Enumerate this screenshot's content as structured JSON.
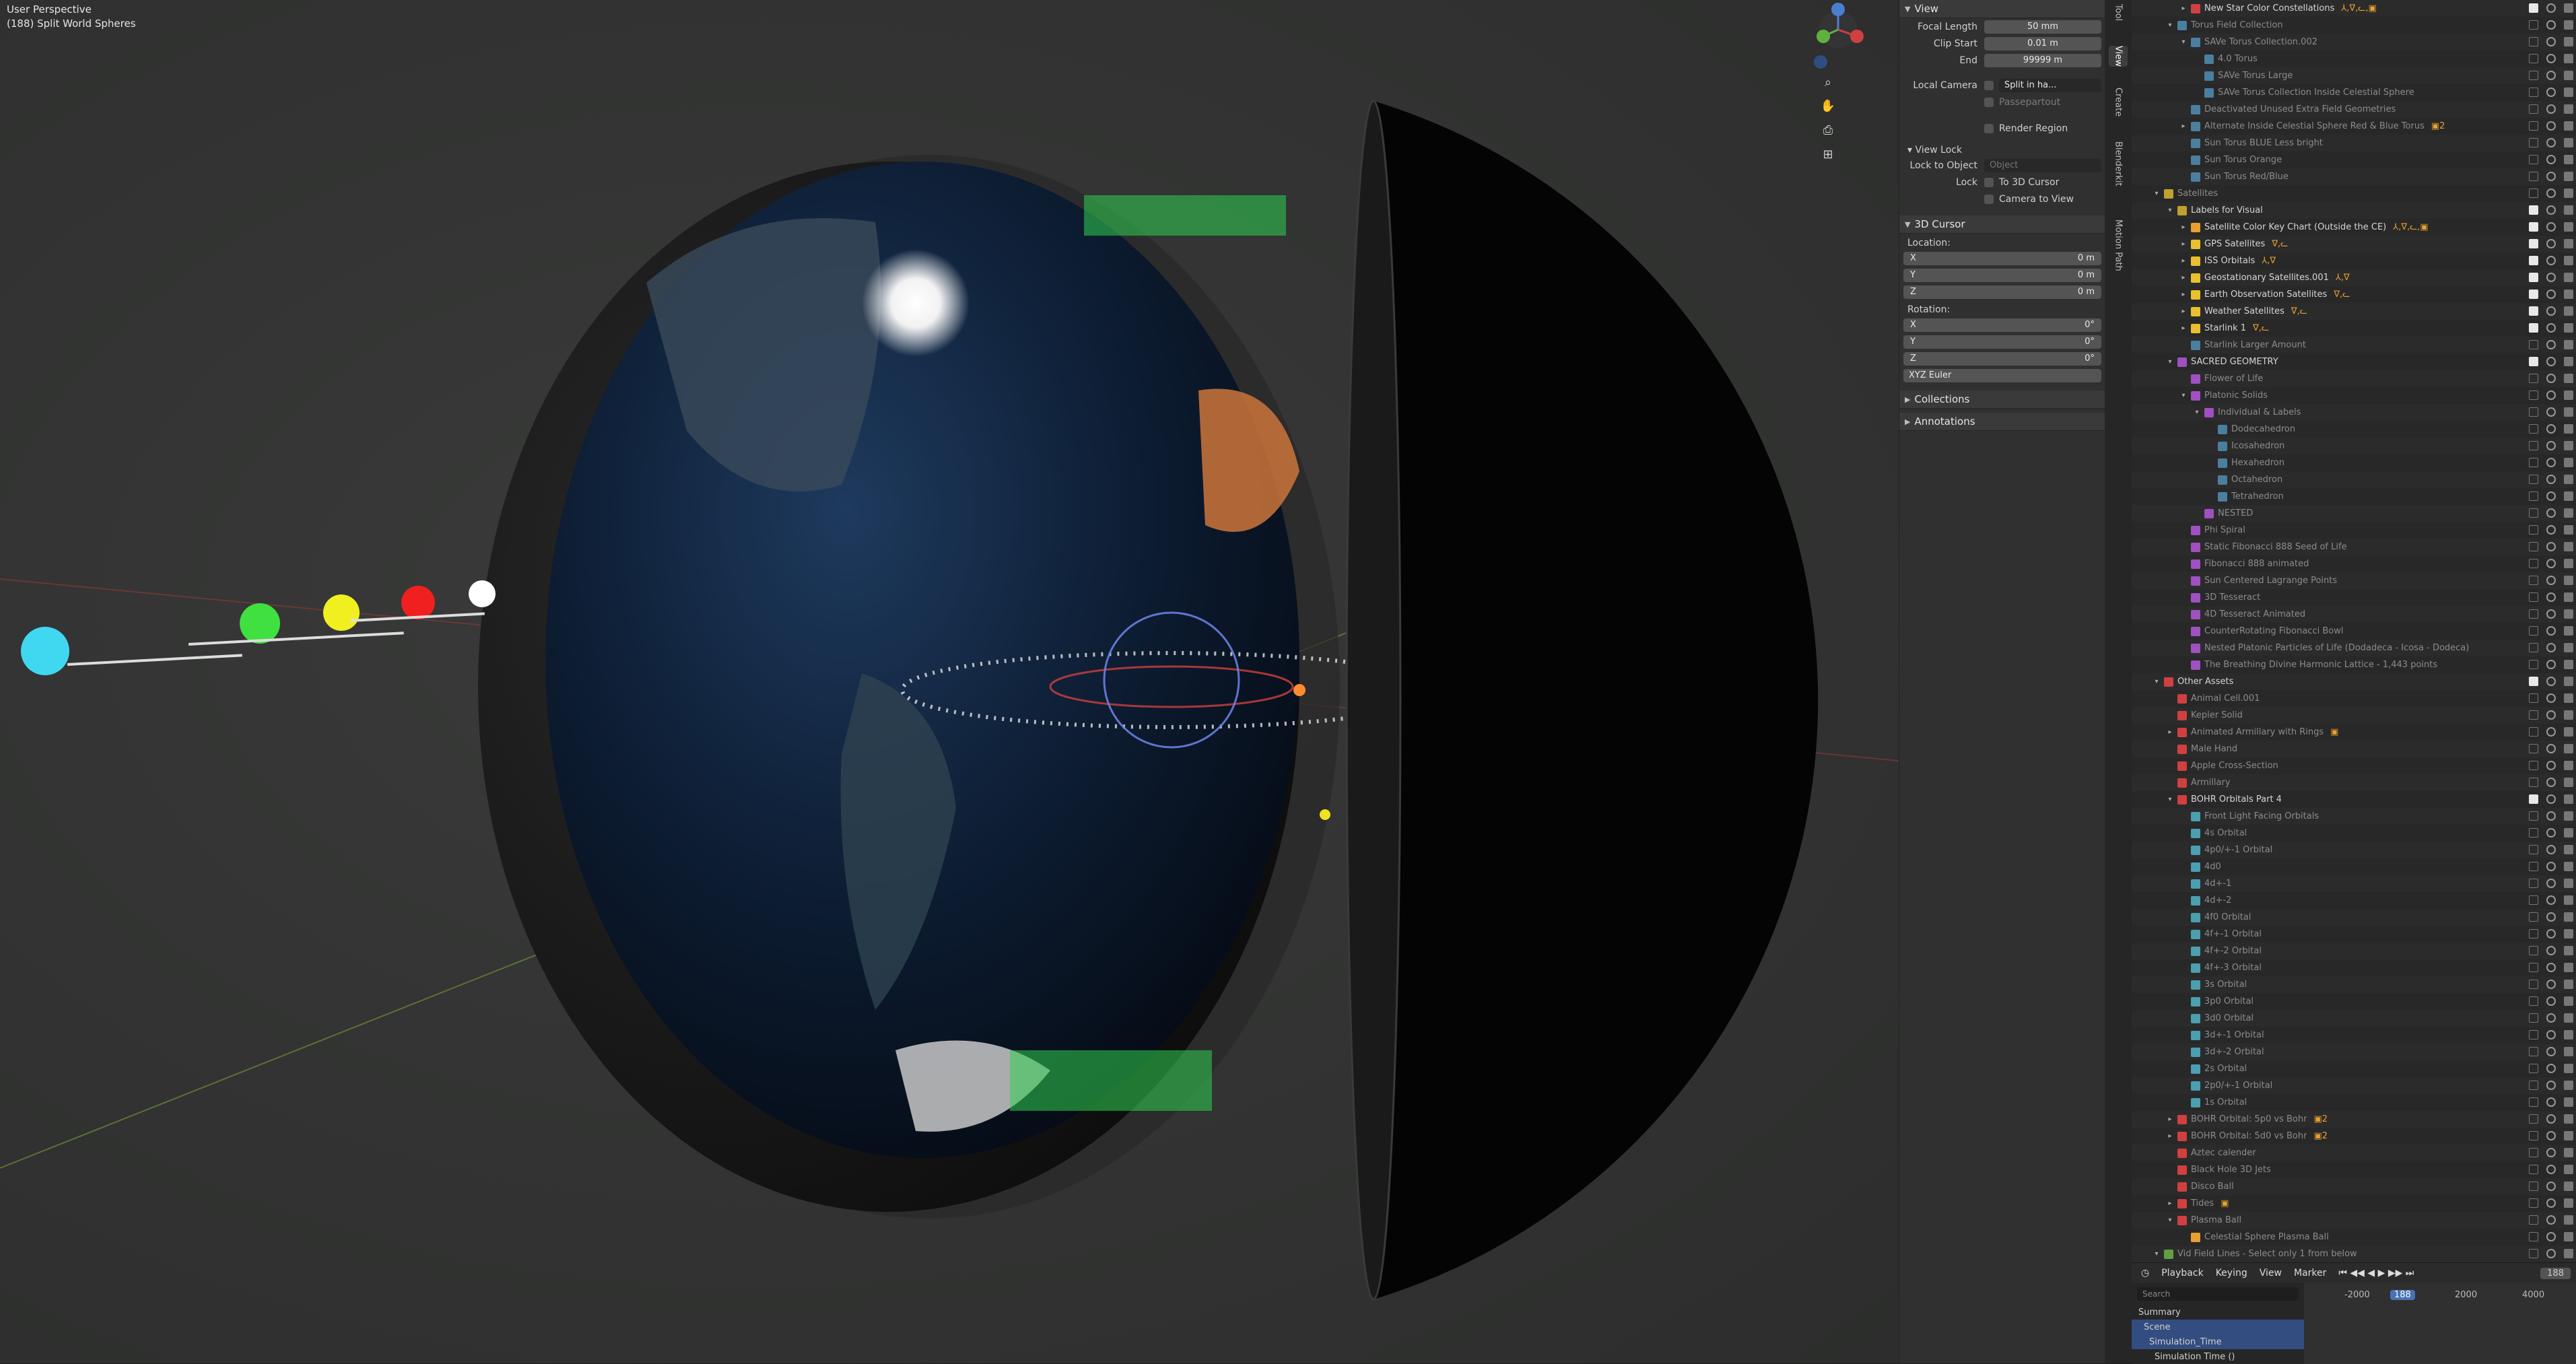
{
  "viewport": {
    "title": "User Perspective",
    "subtitle": "(188) Split World Spheres",
    "nav_icons": [
      "zoom-icon",
      "hand-pan-icon",
      "camera-icon",
      "grid-icon"
    ]
  },
  "npanel": {
    "view_header": "View",
    "focal_length_label": "Focal Length",
    "focal_length_value": "50 mm",
    "clip_start_label": "Clip Start",
    "clip_start_value": "0.01 m",
    "clip_end_label": "End",
    "clip_end_value": "99999 m",
    "local_camera_label": "Local Camera",
    "local_camera_value": "Split in ha...",
    "passepartout_label": "Passepartout",
    "render_region_label": "Render Region",
    "view_lock_header": "View Lock",
    "lock_to_object_label": "Lock to Object",
    "lock_to_object_placeholder": "Object",
    "lock_label": "Lock",
    "to_3d_cursor_label": "To 3D Cursor",
    "camera_to_view_label": "Camera to View",
    "cursor_header": "3D Cursor",
    "location_label": "Location:",
    "loc": [
      {
        "axis": "X",
        "value": "0 m"
      },
      {
        "axis": "Y",
        "value": "0 m"
      },
      {
        "axis": "Z",
        "value": "0 m"
      }
    ],
    "rotation_label": "Rotation:",
    "rot": [
      {
        "axis": "X",
        "value": "0°"
      },
      {
        "axis": "Y",
        "value": "0°"
      },
      {
        "axis": "Z",
        "value": "0°"
      }
    ],
    "rotation_mode": "XYZ Euler",
    "collections_header": "Collections",
    "annotations_header": "Annotations"
  },
  "sidetabs": [
    "Tool",
    "View",
    "Create",
    "Blenderkit",
    "Motion Path"
  ],
  "outliner": {
    "rows": [
      {
        "indent": 3,
        "name": "New Star Color Constellations",
        "color": "#d04040",
        "tri": "▸",
        "dim": false,
        "extra": "⅄,∇,ᓚ,▣"
      },
      {
        "indent": 2,
        "name": "Torus Field Collection",
        "color": "#4a7fa0",
        "tri": "▾",
        "dim": true,
        "extra": ""
      },
      {
        "indent": 3,
        "name": "SAVe Torus Collection.002",
        "color": "#4a7fa0",
        "tri": "▾",
        "dim": true,
        "extra": ""
      },
      {
        "indent": 4,
        "name": "4.0 Torus",
        "color": "#4a7fa0",
        "tri": "",
        "dim": true,
        "extra": ""
      },
      {
        "indent": 4,
        "name": "SAVe Torus Large",
        "color": "#4a7fa0",
        "tri": "",
        "dim": true,
        "extra": ""
      },
      {
        "indent": 4,
        "name": "SAVe Torus Collection Inside Celestial Sphere",
        "color": "#4a7fa0",
        "tri": "",
        "dim": true,
        "extra": ""
      },
      {
        "indent": 3,
        "name": "Deactivated Unused Extra Field Geometries",
        "color": "#4a7fa0",
        "tri": "",
        "dim": true,
        "extra": ""
      },
      {
        "indent": 3,
        "name": "Alternate Inside Celestial Sphere Red & Blue Torus",
        "color": "#4a7fa0",
        "tri": "▸",
        "dim": true,
        "extra": "▣2"
      },
      {
        "indent": 3,
        "name": "Sun Torus BLUE Less bright",
        "color": "#4a7fa0",
        "tri": "",
        "dim": true,
        "extra": ""
      },
      {
        "indent": 3,
        "name": "Sun Torus Orange",
        "color": "#4a7fa0",
        "tri": "",
        "dim": true,
        "extra": ""
      },
      {
        "indent": 3,
        "name": "Sun Torus Red/Blue",
        "color": "#4a7fa0",
        "tri": "",
        "dim": true,
        "extra": ""
      },
      {
        "indent": 1,
        "name": "Satellites",
        "color": "#c0a030",
        "tri": "▾",
        "dim": true,
        "extra": ""
      },
      {
        "indent": 2,
        "name": "Labels for Visual",
        "color": "#c0a030",
        "tri": "▾",
        "dim": false,
        "extra": ""
      },
      {
        "indent": 3,
        "name": "Satellite Color Key Chart (Outside the CE)",
        "color": "#e8a030",
        "tri": "▸",
        "dim": false,
        "extra": "⅄,∇,ᓚ,▣"
      },
      {
        "indent": 3,
        "name": "GPS Satellites",
        "color": "#e8c030",
        "tri": "▸",
        "dim": false,
        "extra": "∇,ᓚ"
      },
      {
        "indent": 3,
        "name": "ISS Orbitals",
        "color": "#e8c030",
        "tri": "▸",
        "dim": false,
        "extra": "⅄,∇"
      },
      {
        "indent": 3,
        "name": "Geostationary Satellites.001",
        "color": "#e8c030",
        "tri": "▸",
        "dim": false,
        "extra": "⅄,∇"
      },
      {
        "indent": 3,
        "name": "Earth Observation Satellites",
        "color": "#e8c030",
        "tri": "▸",
        "dim": false,
        "extra": "∇,ᓚ"
      },
      {
        "indent": 3,
        "name": "Weather Satellites",
        "color": "#e8c030",
        "tri": "▸",
        "dim": false,
        "extra": "∇,ᓚ"
      },
      {
        "indent": 3,
        "name": "Starlink 1",
        "color": "#e8c030",
        "tri": "▸",
        "dim": false,
        "extra": "∇,ᓚ"
      },
      {
        "indent": 3,
        "name": "Starlink Larger Amount",
        "color": "#4a7fa0",
        "tri": "",
        "dim": true,
        "extra": ""
      },
      {
        "indent": 2,
        "name": "SACRED GEOMETRY",
        "color": "#a050c0",
        "tri": "▾",
        "dim": false,
        "extra": ""
      },
      {
        "indent": 3,
        "name": "Flower of Life",
        "color": "#a050c0",
        "tri": "",
        "dim": true,
        "extra": ""
      },
      {
        "indent": 3,
        "name": "Platonic Solids",
        "color": "#a050c0",
        "tri": "▾",
        "dim": true,
        "extra": ""
      },
      {
        "indent": 4,
        "name": "Individual & Labels",
        "color": "#a050c0",
        "tri": "▾",
        "dim": true,
        "extra": ""
      },
      {
        "indent": 5,
        "name": "Dodecahedron",
        "color": "#4a7fa0",
        "tri": "",
        "dim": true,
        "extra": ""
      },
      {
        "indent": 5,
        "name": "Icosahedron",
        "color": "#4a7fa0",
        "tri": "",
        "dim": true,
        "extra": ""
      },
      {
        "indent": 5,
        "name": "Hexahedron",
        "color": "#4a7fa0",
        "tri": "",
        "dim": true,
        "extra": ""
      },
      {
        "indent": 5,
        "name": "Octahedron",
        "color": "#4a7fa0",
        "tri": "",
        "dim": true,
        "extra": ""
      },
      {
        "indent": 5,
        "name": "Tetrahedron",
        "color": "#4a7fa0",
        "tri": "",
        "dim": true,
        "extra": ""
      },
      {
        "indent": 4,
        "name": "NESTED",
        "color": "#a050c0",
        "tri": "",
        "dim": true,
        "extra": ""
      },
      {
        "indent": 3,
        "name": "Phi Spiral",
        "color": "#a050c0",
        "tri": "",
        "dim": true,
        "extra": ""
      },
      {
        "indent": 3,
        "name": "Static Fibonacci 888 Seed of Life",
        "color": "#a050c0",
        "tri": "",
        "dim": true,
        "extra": ""
      },
      {
        "indent": 3,
        "name": "Fibonacci 888 animated",
        "color": "#a050c0",
        "tri": "",
        "dim": true,
        "extra": ""
      },
      {
        "indent": 3,
        "name": "Sun Centered Lagrange Points",
        "color": "#a050c0",
        "tri": "",
        "dim": true,
        "extra": ""
      },
      {
        "indent": 3,
        "name": "3D Tesseract",
        "color": "#a050c0",
        "tri": "",
        "dim": true,
        "extra": ""
      },
      {
        "indent": 3,
        "name": "4D Tesseract Animated",
        "color": "#a050c0",
        "tri": "",
        "dim": true,
        "extra": ""
      },
      {
        "indent": 3,
        "name": "CounterRotating Fibonacci Bowl",
        "color": "#a050c0",
        "tri": "",
        "dim": true,
        "extra": ""
      },
      {
        "indent": 3,
        "name": "Nested Platonic Particles of Life (Dodadeca - Icosa - Dodeca)",
        "color": "#a050c0",
        "tri": "",
        "dim": true,
        "extra": ""
      },
      {
        "indent": 3,
        "name": "The Breathing Divine Harmonic Lattice - 1,443 points",
        "color": "#a050c0",
        "tri": "",
        "dim": true,
        "extra": ""
      },
      {
        "indent": 1,
        "name": "Other Assets",
        "color": "#d04040",
        "tri": "▾",
        "dim": false,
        "extra": ""
      },
      {
        "indent": 2,
        "name": "Animal Cell.001",
        "color": "#d04040",
        "tri": "",
        "dim": true,
        "extra": ""
      },
      {
        "indent": 2,
        "name": "Kepler Solid",
        "color": "#d04040",
        "tri": "",
        "dim": true,
        "extra": ""
      },
      {
        "indent": 2,
        "name": "Animated Armillary with Rings",
        "color": "#d04040",
        "tri": "▸",
        "dim": true,
        "extra": "▣"
      },
      {
        "indent": 2,
        "name": "Male Hand",
        "color": "#d04040",
        "tri": "",
        "dim": true,
        "extra": ""
      },
      {
        "indent": 2,
        "name": "Apple Cross-Section",
        "color": "#d04040",
        "tri": "",
        "dim": true,
        "extra": ""
      },
      {
        "indent": 2,
        "name": "Armillary",
        "color": "#d04040",
        "tri": "",
        "dim": true,
        "extra": ""
      },
      {
        "indent": 2,
        "name": "BOHR Orbitals Part 4",
        "color": "#d04040",
        "tri": "▾",
        "dim": false,
        "extra": ""
      },
      {
        "indent": 3,
        "name": "Front Light Facing Orbitals",
        "color": "#4a9fb0",
        "tri": "",
        "dim": true,
        "extra": ""
      },
      {
        "indent": 3,
        "name": "4s Orbital",
        "color": "#4a9fb0",
        "tri": "",
        "dim": true,
        "extra": ""
      },
      {
        "indent": 3,
        "name": "4p0/+-1 Orbital",
        "color": "#4a9fb0",
        "tri": "",
        "dim": true,
        "extra": ""
      },
      {
        "indent": 3,
        "name": "4d0",
        "color": "#4a9fb0",
        "tri": "",
        "dim": true,
        "extra": ""
      },
      {
        "indent": 3,
        "name": "4d+-1",
        "color": "#4a9fb0",
        "tri": "",
        "dim": true,
        "extra": ""
      },
      {
        "indent": 3,
        "name": "4d+-2",
        "color": "#4a9fb0",
        "tri": "",
        "dim": true,
        "extra": ""
      },
      {
        "indent": 3,
        "name": "4f0 Orbital",
        "color": "#4a9fb0",
        "tri": "",
        "dim": true,
        "extra": ""
      },
      {
        "indent": 3,
        "name": "4f+-1 Orbital",
        "color": "#4a9fb0",
        "tri": "",
        "dim": true,
        "extra": ""
      },
      {
        "indent": 3,
        "name": "4f+-2 Orbital",
        "color": "#4a9fb0",
        "tri": "",
        "dim": true,
        "extra": ""
      },
      {
        "indent": 3,
        "name": "4f+-3 Orbital",
        "color": "#4a9fb0",
        "tri": "",
        "dim": true,
        "extra": ""
      },
      {
        "indent": 3,
        "name": "3s Orbital",
        "color": "#4a9fb0",
        "tri": "",
        "dim": true,
        "extra": ""
      },
      {
        "indent": 3,
        "name": "3p0 Orbital",
        "color": "#4a9fb0",
        "tri": "",
        "dim": true,
        "extra": ""
      },
      {
        "indent": 3,
        "name": "3d0 Orbital",
        "color": "#4a9fb0",
        "tri": "",
        "dim": true,
        "extra": ""
      },
      {
        "indent": 3,
        "name": "3d+-1 Orbital",
        "color": "#4a9fb0",
        "tri": "",
        "dim": true,
        "extra": ""
      },
      {
        "indent": 3,
        "name": "3d+-2 Orbital",
        "color": "#4a9fb0",
        "tri": "",
        "dim": true,
        "extra": ""
      },
      {
        "indent": 3,
        "name": "2s Orbital",
        "color": "#4a9fb0",
        "tri": "",
        "dim": true,
        "extra": ""
      },
      {
        "indent": 3,
        "name": "2p0/+-1 Orbital",
        "color": "#4a9fb0",
        "tri": "",
        "dim": true,
        "extra": ""
      },
      {
        "indent": 3,
        "name": "1s Orbital",
        "color": "#4a9fb0",
        "tri": "",
        "dim": true,
        "extra": ""
      },
      {
        "indent": 2,
        "name": "BOHR Orbital: 5p0 vs Bohr",
        "color": "#d04040",
        "tri": "▸",
        "dim": true,
        "extra": "▣2"
      },
      {
        "indent": 2,
        "name": "BOHR Orbital: 5d0 vs Bohr",
        "color": "#d04040",
        "tri": "▸",
        "dim": true,
        "extra": "▣2"
      },
      {
        "indent": 2,
        "name": "Aztec calender",
        "color": "#d04040",
        "tri": "",
        "dim": true,
        "extra": ""
      },
      {
        "indent": 2,
        "name": "Black Hole 3D Jets",
        "color": "#d04040",
        "tri": "",
        "dim": true,
        "extra": ""
      },
      {
        "indent": 2,
        "name": "Disco Ball",
        "color": "#d04040",
        "tri": "",
        "dim": true,
        "extra": ""
      },
      {
        "indent": 2,
        "name": "Tides",
        "color": "#d04040",
        "tri": "▸",
        "dim": true,
        "extra": "▣"
      },
      {
        "indent": 2,
        "name": "Plasma Ball",
        "color": "#d04040",
        "tri": "▾",
        "dim": true,
        "extra": ""
      },
      {
        "indent": 3,
        "name": "Celestial Sphere Plasma Ball",
        "color": "#e8a030",
        "tri": "",
        "dim": true,
        "extra": ""
      },
      {
        "indent": 1,
        "name": "Vid Field Lines - Select only 1 from below",
        "color": "#60a040",
        "tri": "▾",
        "dim": true,
        "extra": ""
      }
    ]
  },
  "timeline": {
    "playback": "Playback",
    "keying": "Keying",
    "view": "View",
    "marker": "Marker",
    "frame": "188",
    "ruler": [
      {
        "label": "-2000",
        "pos": 0.14
      },
      {
        "label": "188",
        "pos": 0.31,
        "current": true
      },
      {
        "label": "2000",
        "pos": 0.55
      },
      {
        "label": "4000",
        "pos": 0.8
      }
    ],
    "search_placeholder": "Search",
    "items": [
      {
        "label": "Summary",
        "sel": false
      },
      {
        "label": "Scene",
        "sel": true
      },
      {
        "label": "Simulation_Time",
        "sel": true
      },
      {
        "label": "Simulation Time ()",
        "sel": false
      }
    ]
  },
  "colors": {
    "accent": "#4772b3",
    "panel": "#303030",
    "outliner": "#282828"
  }
}
